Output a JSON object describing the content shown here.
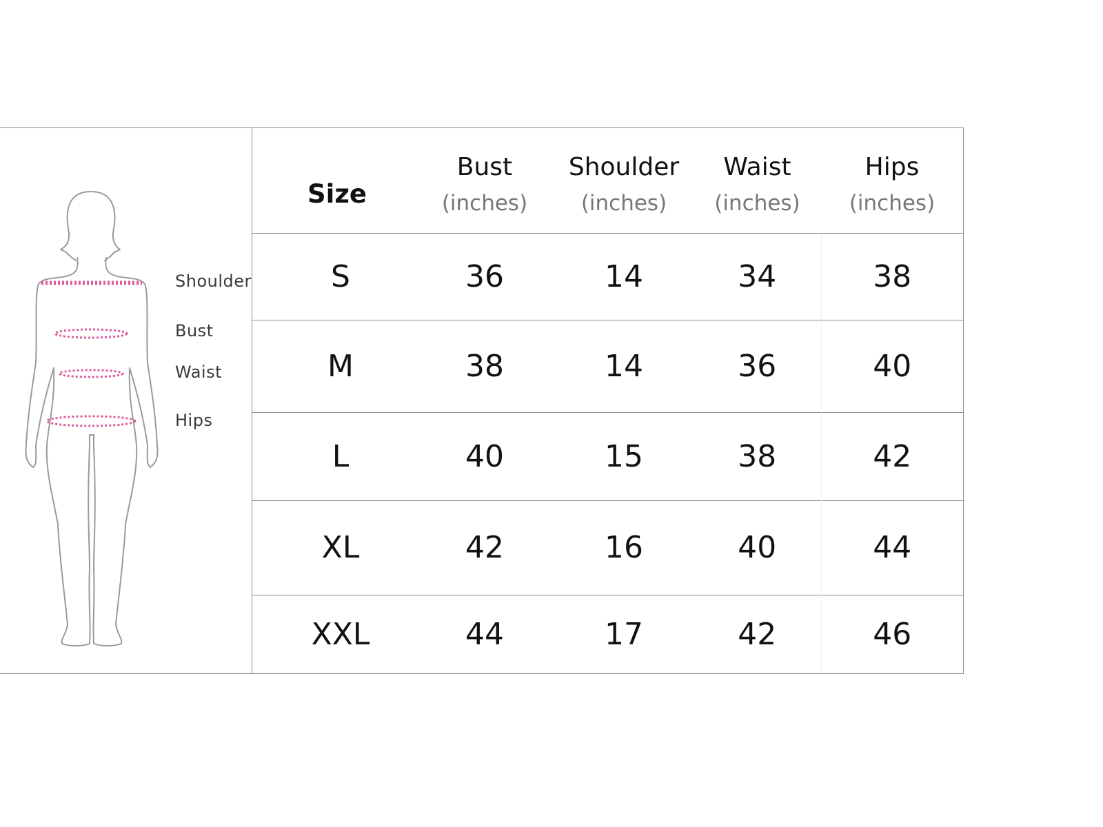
{
  "figure": {
    "labels": {
      "shoulder": "Shoulder",
      "bust": "Bust",
      "waist": "Waist",
      "hips": "Hips"
    },
    "measure_line_color": "#e05a9a",
    "outline_color": "#9a9a9a"
  },
  "table": {
    "header": {
      "size": "Size",
      "columns": [
        {
          "name": "Bust",
          "unit": "(inches)"
        },
        {
          "name": "Shoulder",
          "unit": "(inches)"
        },
        {
          "name": "Waist",
          "unit": "(inches)"
        },
        {
          "name": "Hips",
          "unit": "(inches)"
        }
      ]
    },
    "rows": [
      {
        "size": "S",
        "bust": "36",
        "shoulder": "14",
        "waist": "34",
        "hips": "38"
      },
      {
        "size": "M",
        "bust": "38",
        "shoulder": "14",
        "waist": "36",
        "hips": "40"
      },
      {
        "size": "L",
        "bust": "40",
        "shoulder": "15",
        "waist": "38",
        "hips": "42"
      },
      {
        "size": "XL",
        "bust": "42",
        "shoulder": "16",
        "waist": "40",
        "hips": "44"
      },
      {
        "size": "XXL",
        "bust": "44",
        "shoulder": "17",
        "waist": "42",
        "hips": "46"
      }
    ]
  }
}
